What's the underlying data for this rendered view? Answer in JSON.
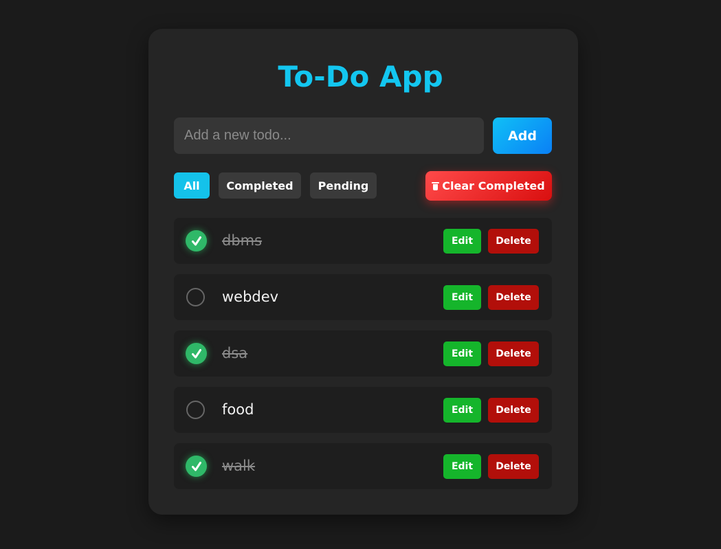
{
  "app": {
    "title": "To-Do App",
    "accent_color": "#13c6f0"
  },
  "new_todo": {
    "value": "",
    "placeholder": "Add a new todo...",
    "add_label": "Add"
  },
  "filters": {
    "all_label": "All",
    "completed_label": "Completed",
    "pending_label": "Pending",
    "active": "All",
    "clear_label": "Clear Completed",
    "clear_icon": "trash-icon"
  },
  "todos": [
    {
      "text": "dbms",
      "completed": true
    },
    {
      "text": "webdev",
      "completed": false
    },
    {
      "text": "dsa",
      "completed": true
    },
    {
      "text": "food",
      "completed": false
    },
    {
      "text": "walk",
      "completed": true
    }
  ],
  "item_actions": {
    "edit_label": "Edit",
    "delete_label": "Delete",
    "check_icon": "checkmark-icon"
  },
  "colors": {
    "completed_check": "#2fb868",
    "edit": "#15b52b",
    "delete": "#b20f0a",
    "clear": "#e62222",
    "add": "#0a9cf6"
  }
}
